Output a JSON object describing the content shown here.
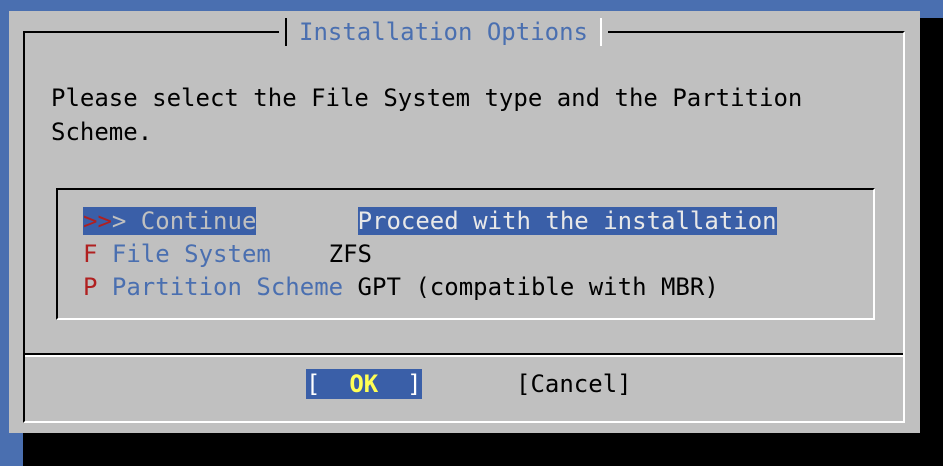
{
  "dialog": {
    "title": "Installation Options",
    "prompt": "Please select the File System type and the Partition\nScheme."
  },
  "menu": {
    "items": [
      {
        "hotkey": ">>",
        "label": "> Continue",
        "pad": "       ",
        "description": "Proceed with the installation",
        "selected": true
      },
      {
        "hotkey": "F",
        "label": " File System",
        "pad": "    ",
        "description": "ZFS",
        "selected": false
      },
      {
        "hotkey": "P",
        "label": " Partition Scheme",
        "pad": " ",
        "description": "GPT (compatible with MBR)",
        "selected": false
      }
    ]
  },
  "buttons": {
    "ok": {
      "open": "[  ",
      "label": "OK",
      "close": "  ]"
    },
    "cancel": "[Cancel]"
  },
  "colors": {
    "dialog_bg": "#c0c0c0",
    "accent_blue": "#4a6fb0",
    "selection_bg": "#3a5fa8",
    "hotkey_red": "#b02020",
    "ok_yellow": "#ffff55"
  }
}
